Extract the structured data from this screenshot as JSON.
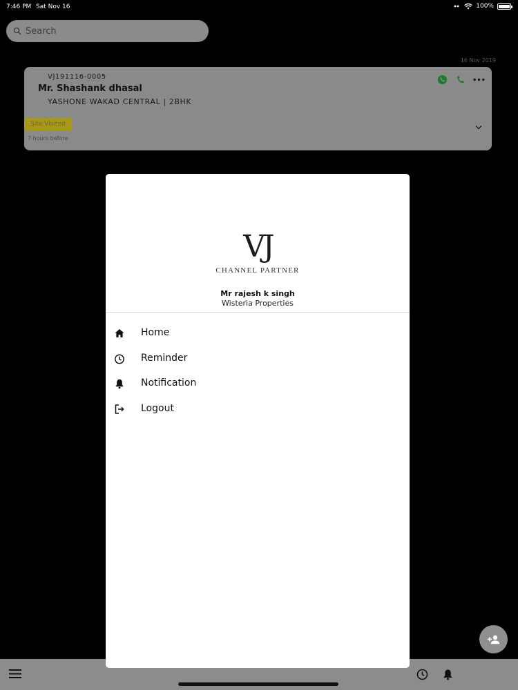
{
  "status_bar": {
    "time": "7:46 PM",
    "date": "Sat Nov 16",
    "battery": "100%"
  },
  "search": {
    "placeholder": "Search"
  },
  "lead_card": {
    "date": "16 Nov 2019",
    "id": "VJ191116-0005",
    "name": "Mr. Shashank dhasal",
    "project": "YASHONE WAKAD CENTRAL | 2BHK",
    "status_badge": "Site Visited",
    "time_ago": "7 hours before",
    "icons": [
      "whatsapp-icon",
      "phone-icon",
      "more-icon",
      "chevron-down-icon"
    ]
  },
  "drawer": {
    "logo_mark": "VJ",
    "logo_tagline": "CHANNEL PARTNER",
    "user_name": "Mr rajesh k singh",
    "user_company": "Wisteria Properties",
    "menu": [
      {
        "label": "Home",
        "icon": "home-icon"
      },
      {
        "label": "Reminder",
        "icon": "clock-icon"
      },
      {
        "label": "Notification",
        "icon": "bell-icon"
      },
      {
        "label": "Logout",
        "icon": "logout-icon"
      }
    ]
  },
  "bottom_bar": {
    "icons": [
      "menu-icon",
      "clock-icon",
      "bell-icon"
    ]
  },
  "fab": {
    "icon": "add-user-icon"
  },
  "colors": {
    "background": "#000000",
    "dimmed_surface": "#8a8a8a",
    "badge": "#a8981a",
    "whatsapp": "#1f7a2e",
    "drawer": "#ffffff"
  }
}
